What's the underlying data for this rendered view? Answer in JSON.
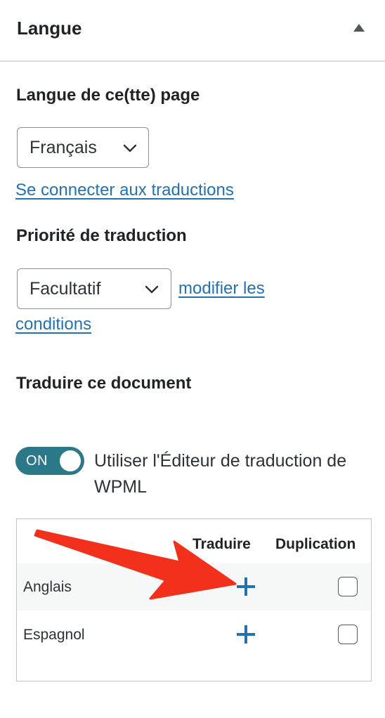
{
  "panel": {
    "title": "Langue"
  },
  "language": {
    "label": "Langue de ce(tte) page",
    "selected": "Français",
    "connect_link": "Se connecter aux traductions"
  },
  "priority": {
    "label": "Priorité de traduction",
    "selected": "Facultatif",
    "edit_link_line1": "modifier les",
    "edit_link_line2": "conditions"
  },
  "translate": {
    "label": "Traduire ce document",
    "toggle_text": "ON",
    "toggle_label": "Utiliser l'Éditeur de traduction de WPML",
    "columns": {
      "translate": "Traduire",
      "duplicate": "Duplication"
    },
    "rows": [
      {
        "language": "Anglais"
      },
      {
        "language": "Espagnol"
      }
    ]
  },
  "colors": {
    "link": "#2271b1",
    "toggle_on": "#2b7889",
    "annotation_arrow": "#f2301b"
  },
  "icons": {
    "collapse": "triangle-up-icon",
    "dropdown": "chevron-down-icon",
    "add_translation": "plus-icon",
    "annotation": "red-arrow-icon"
  }
}
